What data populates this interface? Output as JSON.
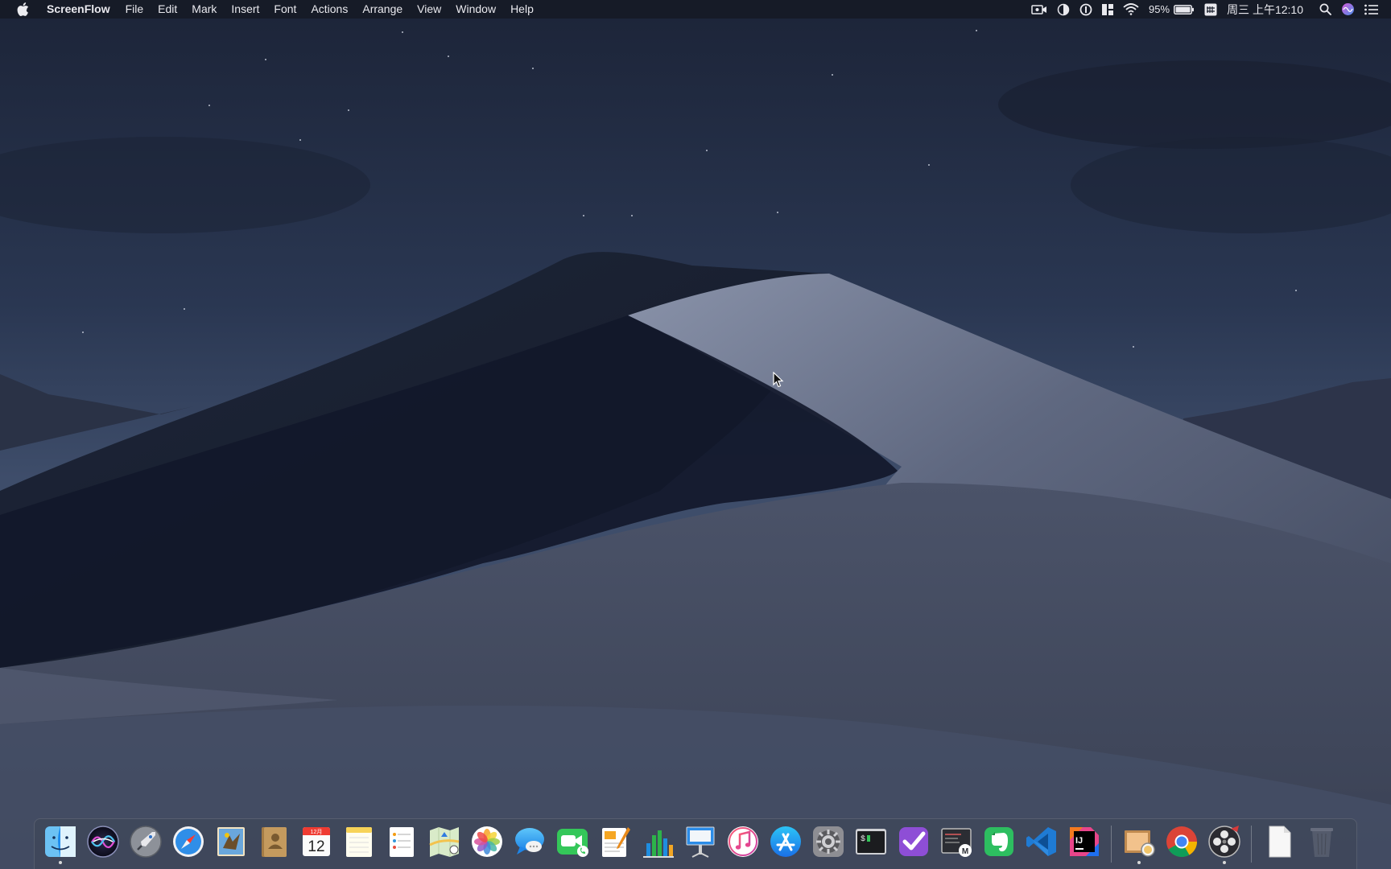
{
  "menubar": {
    "app_name": "ScreenFlow",
    "menus": [
      "File",
      "Edit",
      "Mark",
      "Insert",
      "Font",
      "Actions",
      "Arrange",
      "View",
      "Window",
      "Help"
    ],
    "battery_percent": "95%",
    "clock": "周三 上午12:10"
  },
  "dock": {
    "apps": [
      {
        "name": "finder-icon",
        "running": true
      },
      {
        "name": "siri-icon",
        "running": false
      },
      {
        "name": "launchpad-icon",
        "running": false
      },
      {
        "name": "safari-icon",
        "running": false
      },
      {
        "name": "mail-icon",
        "running": false
      },
      {
        "name": "contacts-icon",
        "running": false
      },
      {
        "name": "calendar-icon",
        "running": false,
        "month": "12月",
        "day": "12"
      },
      {
        "name": "notes-icon",
        "running": false
      },
      {
        "name": "reminders-icon",
        "running": false
      },
      {
        "name": "maps-icon",
        "running": false
      },
      {
        "name": "photos-icon",
        "running": false
      },
      {
        "name": "messages-icon",
        "running": false
      },
      {
        "name": "facetime-icon",
        "running": false
      },
      {
        "name": "pages-icon",
        "running": false
      },
      {
        "name": "numbers-icon",
        "running": false
      },
      {
        "name": "keynote-icon",
        "running": false
      },
      {
        "name": "itunes-icon",
        "running": false
      },
      {
        "name": "app-store-icon",
        "running": false
      },
      {
        "name": "system-preferences-icon",
        "running": false
      },
      {
        "name": "terminal-icon",
        "running": false,
        "label": "$"
      },
      {
        "name": "omnifocus-icon",
        "running": false
      },
      {
        "name": "mweb-icon",
        "running": false,
        "label": "M"
      },
      {
        "name": "evernote-icon",
        "running": false
      },
      {
        "name": "vscode-icon",
        "running": false
      },
      {
        "name": "intellij-icon",
        "running": false,
        "label": "IJ"
      }
    ],
    "recent_apps": [
      {
        "name": "preview-icon",
        "running": true
      },
      {
        "name": "chrome-icon",
        "running": false
      },
      {
        "name": "screenflow-icon",
        "running": true
      }
    ],
    "stacks": [
      {
        "name": "document-stack-icon",
        "running": false
      },
      {
        "name": "trash-icon",
        "running": false
      }
    ]
  }
}
